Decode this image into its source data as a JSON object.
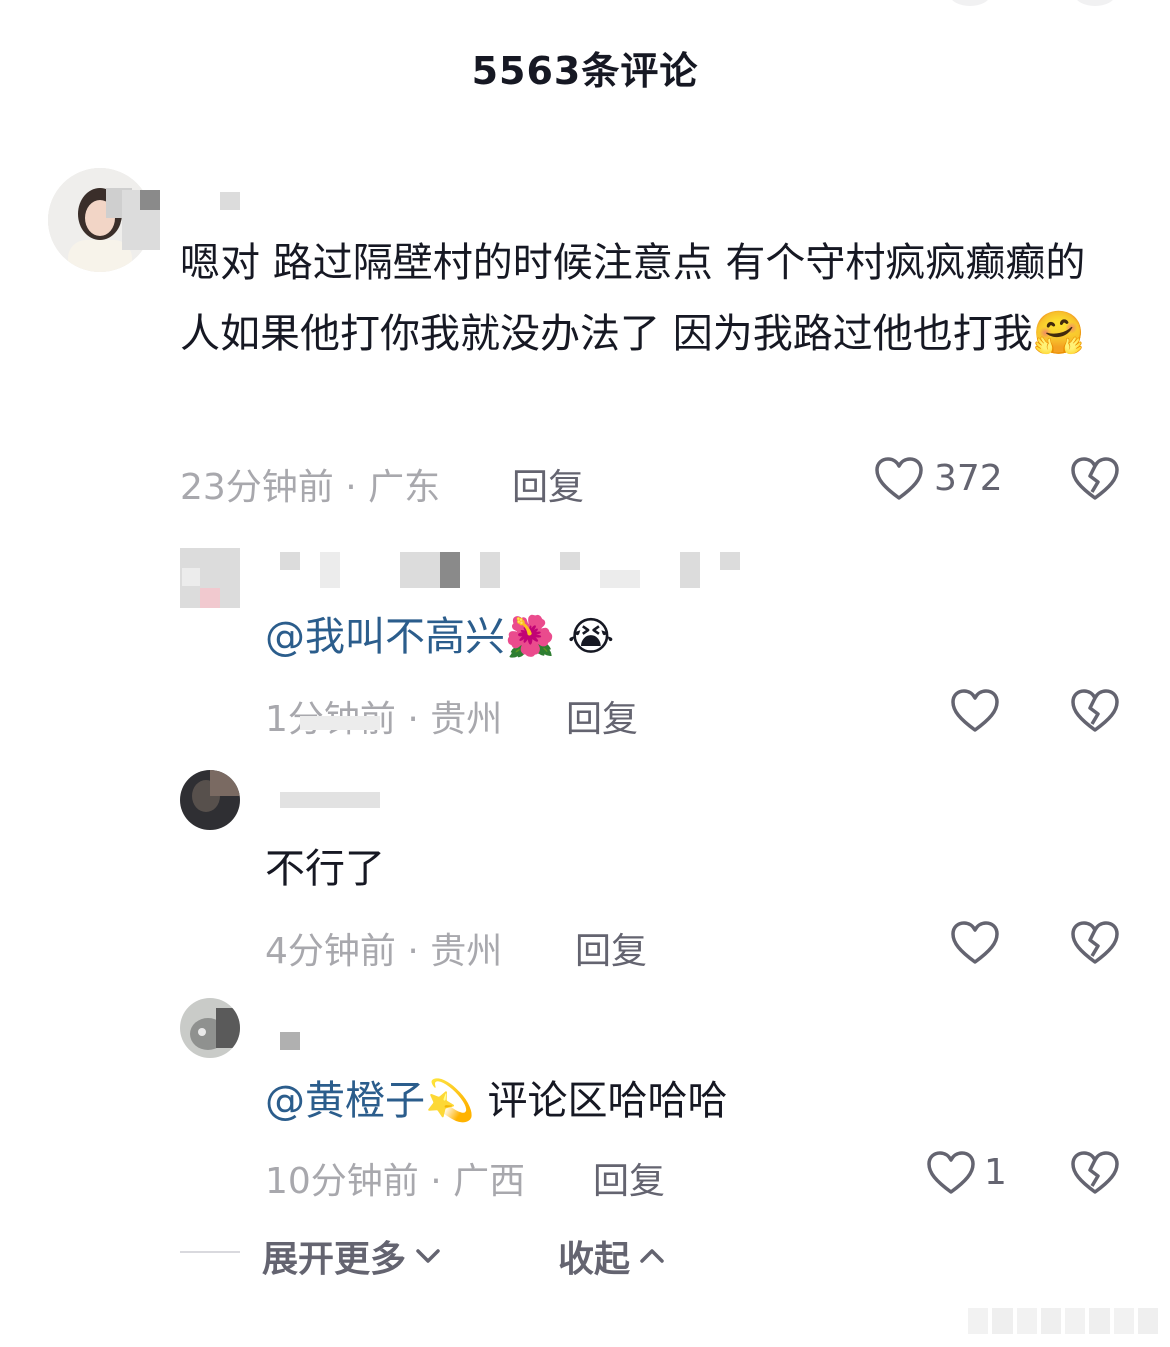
{
  "header": {
    "title": "5563条评论"
  },
  "comments": [
    {
      "text": "嗯对 路过隔壁村的时候注意点 有个守村疯疯癫癫的人如果他打你我就没办法了 因为我路过他也打我",
      "emoji": "🤗",
      "time_location": "23分钟前 · 广东",
      "reply_label": "回复",
      "like_count": "372"
    }
  ],
  "replies": [
    {
      "mention": "@我叫不高兴",
      "emojis": "🌺 😭",
      "text": "",
      "time_location": "1分钟前 · 贵州",
      "reply_label": "回复",
      "like_count": ""
    },
    {
      "mention": "",
      "text": "不行了",
      "time_location": "4分钟前 · 贵州",
      "reply_label": "回复",
      "like_count": ""
    },
    {
      "mention": "@黄橙子",
      "emojis": "💫",
      "text": "评论区哈哈哈",
      "time_location": "10分钟前 · 广西",
      "reply_label": "回复",
      "like_count": "1"
    }
  ],
  "footer": {
    "expand_label": "展开更多",
    "collapse_label": "收起"
  },
  "colors": {
    "mention": "#2b5d8c",
    "meta": "#a8a8ad",
    "action": "#646470",
    "text": "#161823"
  },
  "icons": [
    "heart-icon",
    "dislike-broken-heart-icon",
    "chevron-down-icon",
    "chevron-up-icon"
  ]
}
